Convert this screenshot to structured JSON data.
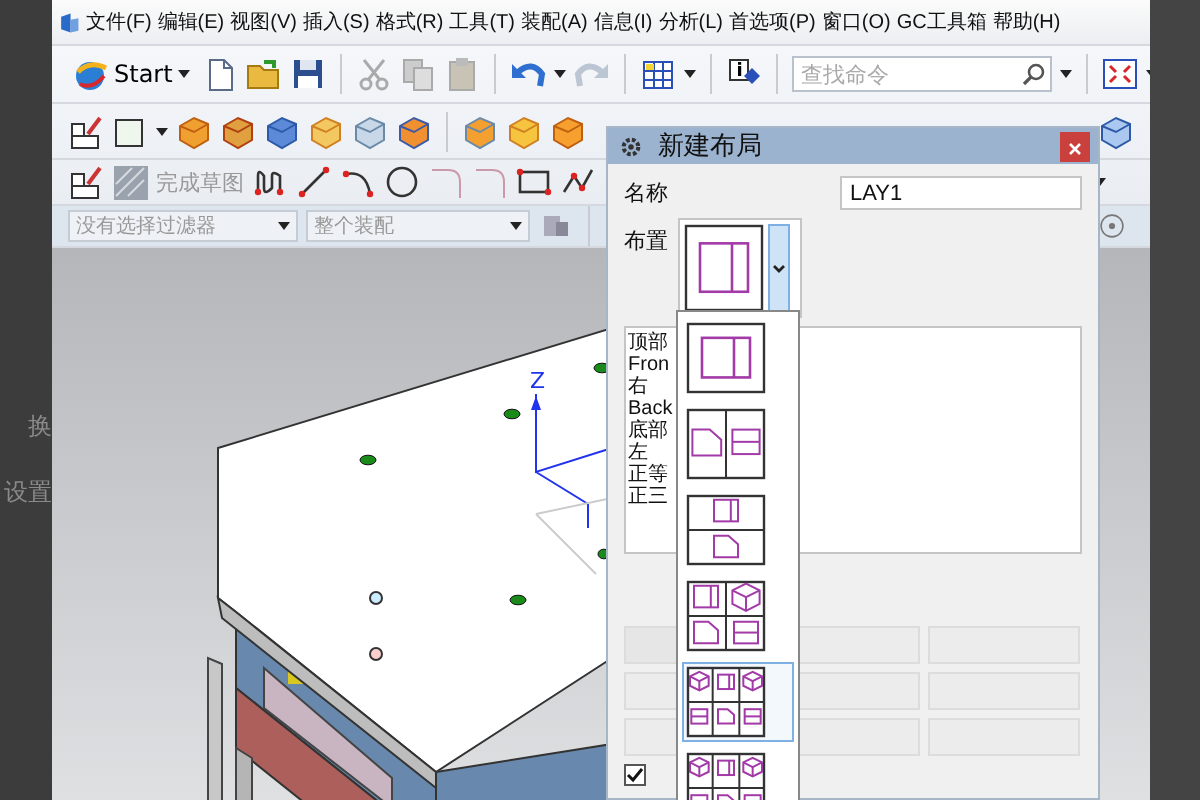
{
  "side_texts": [
    "换",
    "设置"
  ],
  "menu": [
    "文件(F)",
    "编辑(E)",
    "视图(V)",
    "插入(S)",
    "格式(R)",
    "工具(T)",
    "装配(A)",
    "信息(I)",
    "分析(L)",
    "首选项(P)",
    "窗口(O)",
    "GC工具箱",
    "帮助(H)"
  ],
  "toolbar": {
    "start_label": "Start",
    "search": {
      "placeholder": "查找命令"
    }
  },
  "sketch_bar": {
    "finish_label": "完成草图",
    "disabled": true
  },
  "filters": [
    {
      "value": "没有选择过滤器",
      "disabled": true
    },
    {
      "value": "整个装配",
      "disabled": true
    }
  ],
  "viewport": {
    "axis_label": "Z"
  },
  "dialog": {
    "title": "新建布局",
    "name_label": "名称",
    "name_value": "LAY1",
    "layout_label": "布置",
    "layout_current": {
      "kind": "split2"
    },
    "views": [
      "顶部",
      "Fron",
      "右",
      "Back",
      "底部",
      "左",
      "正等",
      "正三"
    ],
    "layout_options": [
      {
        "kind": "split2",
        "selected": false
      },
      {
        "kind": "split3",
        "selected": false
      },
      {
        "kind": "stack2",
        "selected": false
      },
      {
        "kind": "quad",
        "selected": false
      },
      {
        "kind": "six",
        "selected": true
      },
      {
        "kind": "six",
        "selected": false
      }
    ],
    "checkbox": {
      "checked": true
    }
  }
}
